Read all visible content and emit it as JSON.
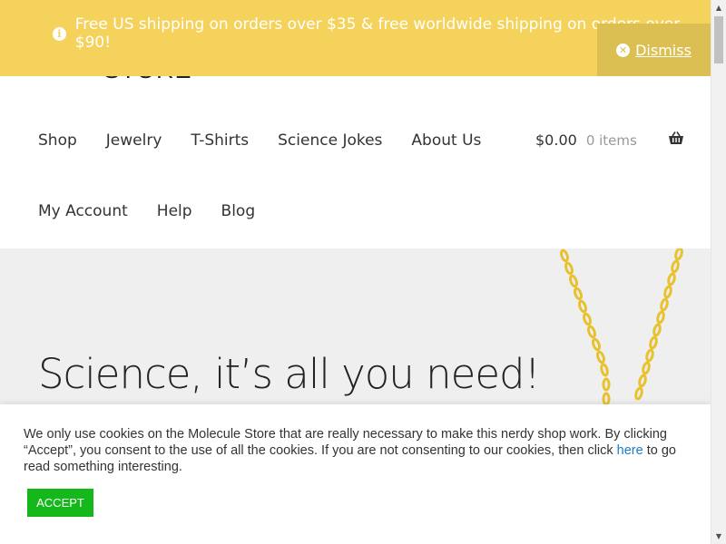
{
  "notice": {
    "text": "Free US shipping on orders over $35 & free worldwide shipping on orders over $90!",
    "dismiss_label": "Dismiss"
  },
  "header": {
    "logo_text": "STORE",
    "nav_row1": [
      "Shop",
      "Jewelry",
      "T-Shirts",
      "Science Jokes",
      "About Us"
    ],
    "nav_row2": [
      "My Account",
      "Help",
      "Blog"
    ],
    "cart": {
      "amount": "$0.00",
      "count": "0 items"
    }
  },
  "hero": {
    "title": "Science, it’s all you need!"
  },
  "cookie": {
    "text_before": "We only use cookies on the Molecule Store that are really necessary to make this nerdy shop work. By clicking “Accept”, you consent to the use of all the cookies. If you are not consenting to our cookies, then click",
    "link": "here",
    "text_after": "to go read something interesting.",
    "accept_label": "ACCEPT"
  },
  "colors": {
    "notice_bg": "#f5d25b",
    "dismiss_bg": "#dbbf52",
    "accept_bg": "#14b81a",
    "hero_bg": "#efefef"
  }
}
